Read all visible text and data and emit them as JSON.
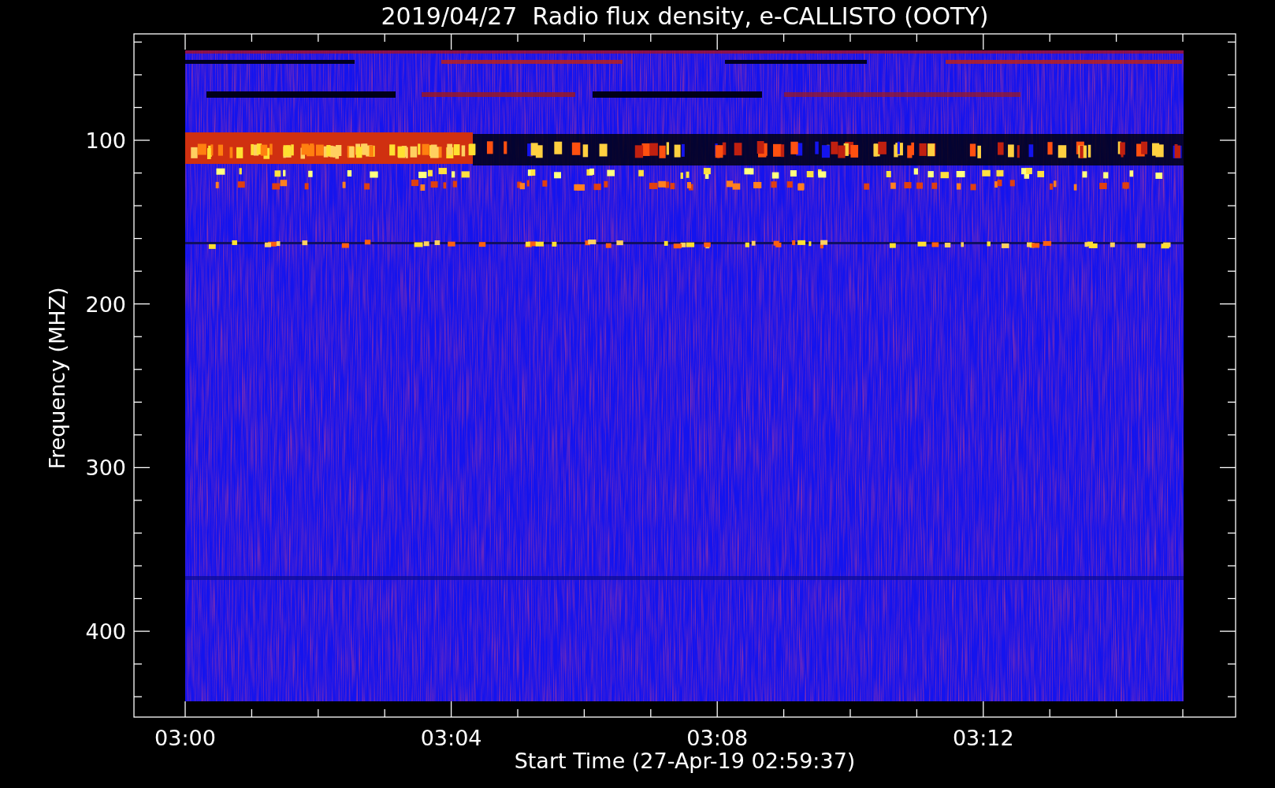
{
  "title": "2019/04/27  Radio flux density, e-CALLISTO (OOTY)",
  "y_axis": {
    "label": "Frequency (MHZ)",
    "ticks": [
      "100",
      "200",
      "300",
      "400"
    ]
  },
  "x_axis": {
    "label": "Start Time (27-Apr-19 02:59:37)",
    "ticks": [
      "03:00",
      "03:04",
      "03:08",
      "03:12"
    ]
  }
}
